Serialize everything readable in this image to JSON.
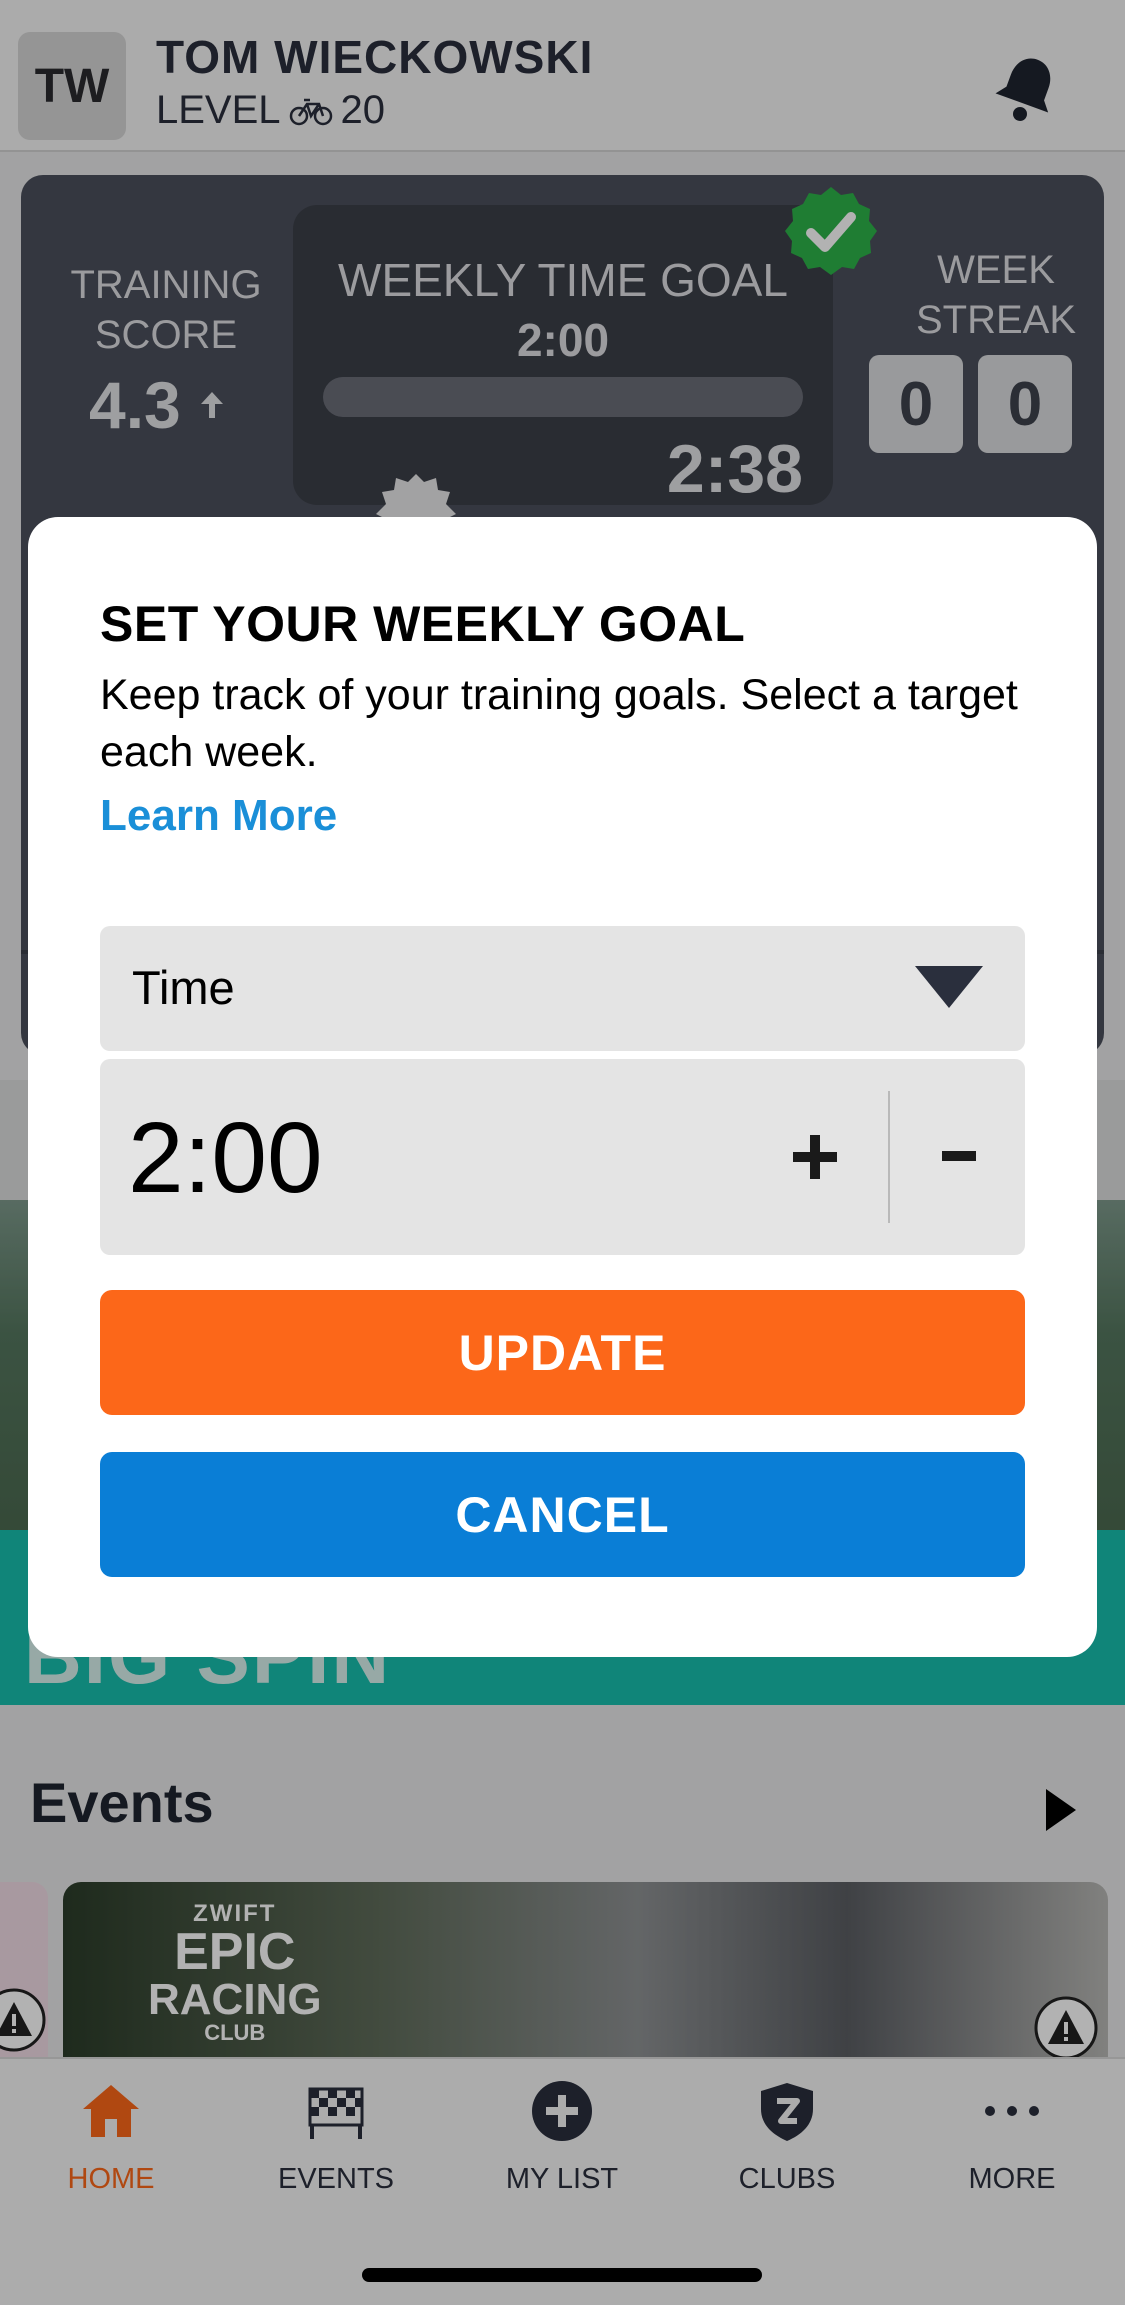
{
  "header": {
    "avatar_initials": "TW",
    "user_name": "TOM WIECKOWSKI",
    "level_label": "LEVEL",
    "level_value": "20"
  },
  "stats": {
    "training_score_label": "TRAINING SCORE",
    "training_score_value": "4.3",
    "goal_title": "WEEKLY TIME GOAL",
    "goal_target": "2:00",
    "goal_actual": "2:38",
    "goal_progress": 1.0,
    "week_streak_label": "WEEK STREAK",
    "streak_digits": [
      "0",
      "0"
    ]
  },
  "background": {
    "banner_text": "BIG SPIN",
    "events_title": "Events",
    "event_brand": {
      "line1": "ZWIFT",
      "line2": "EPIC",
      "line3": "RACING",
      "line4": "CLUB"
    }
  },
  "modal": {
    "title": "SET YOUR WEEKLY GOAL",
    "description": "Keep track of your training goals. Select a target each week.",
    "learn_more": "Learn More",
    "goal_type": "Time",
    "goal_value": "2:00",
    "update_label": "UPDATE",
    "cancel_label": "CANCEL"
  },
  "tabbar": {
    "tabs": [
      {
        "label": "HOME",
        "icon": "home-icon",
        "active": true
      },
      {
        "label": "EVENTS",
        "icon": "checkered-flag-icon",
        "active": false
      },
      {
        "label": "MY LIST",
        "icon": "plus-circle-icon",
        "active": false
      },
      {
        "label": "CLUBS",
        "icon": "shield-icon",
        "active": false
      },
      {
        "label": "MORE",
        "icon": "more-dots-icon",
        "active": false
      }
    ]
  },
  "colors": {
    "accent_orange": "#fc6719",
    "action_blue": "#0a7ed6",
    "link_blue": "#1a8fd8",
    "card_dark": "#4b505c",
    "success_green": "#2db34a"
  }
}
